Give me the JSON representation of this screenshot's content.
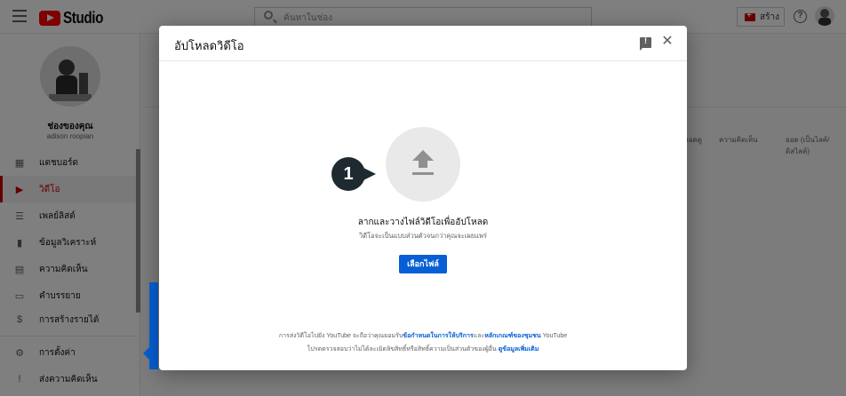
{
  "app": {
    "logo_text": "Studio",
    "search_placeholder": "ค้นหาในช่อง",
    "create_label": "สร้าง",
    "help_symbol": "?"
  },
  "sidebar": {
    "channel_name": "ช่องของคุณ",
    "channel_handle": "adison roopian",
    "items": [
      {
        "label": "แดชบอร์ด",
        "icon": "dashboard-icon",
        "glyph": "▦"
      },
      {
        "label": "วิดีโอ",
        "icon": "video-icon",
        "glyph": "▶"
      },
      {
        "label": "เพลย์ลิสต์",
        "icon": "playlist-icon",
        "glyph": "☰"
      },
      {
        "label": "ข้อมูลวิเคราะห์",
        "icon": "analytics-icon",
        "glyph": "▮"
      },
      {
        "label": "ความคิดเห็น",
        "icon": "comments-icon",
        "glyph": "▤"
      },
      {
        "label": "คำบรรยาย",
        "icon": "subtitles-icon",
        "glyph": "▭"
      },
      {
        "label": "การสร้างรายได้",
        "icon": "monetization-icon",
        "glyph": "$"
      },
      {
        "label": "การตั้งค่า",
        "icon": "settings-icon",
        "glyph": "⚙"
      },
      {
        "label": "ส่งความคิดเห็น",
        "icon": "feedback-icon",
        "glyph": "!"
      }
    ],
    "active_index": 1
  },
  "background": {
    "col_1": "ยอดดู",
    "col_2": "ความคิดเห็น",
    "col_3": "ยอด (เป็นไลค์/ดิสไลค์)"
  },
  "modal": {
    "title": "อัปโหลดวิดีโอ",
    "close_symbol": "✕",
    "step_number": "1",
    "drop_title": "ลากและวางไฟล์วิดีโอเพื่ออัปโหลด",
    "drop_subtitle": "วิดีโอจะเป็นแบบส่วนตัวจนกว่าคุณจะเผยแพร่",
    "select_button": "เลือกไฟล์",
    "terms_prefix": "การส่งวิดีโอไปยัง YouTube จะถือว่าคุณยอมรับ",
    "terms_link_1": "ข้อกำหนดในการให้บริการ",
    "terms_mid": "และ",
    "terms_link_2": "หลักเกณฑ์ของชุมชน",
    "terms_suffix": " YouTube",
    "terms2_text": "โปรดตรวจสอบว่าไม่ได้ละเมิดลิขสิทธิ์หรือสิทธิ์ความเป็นส่วนตัวของผู้อื่น ",
    "terms2_link": "ดูข้อมูลเพิ่มเติม"
  }
}
